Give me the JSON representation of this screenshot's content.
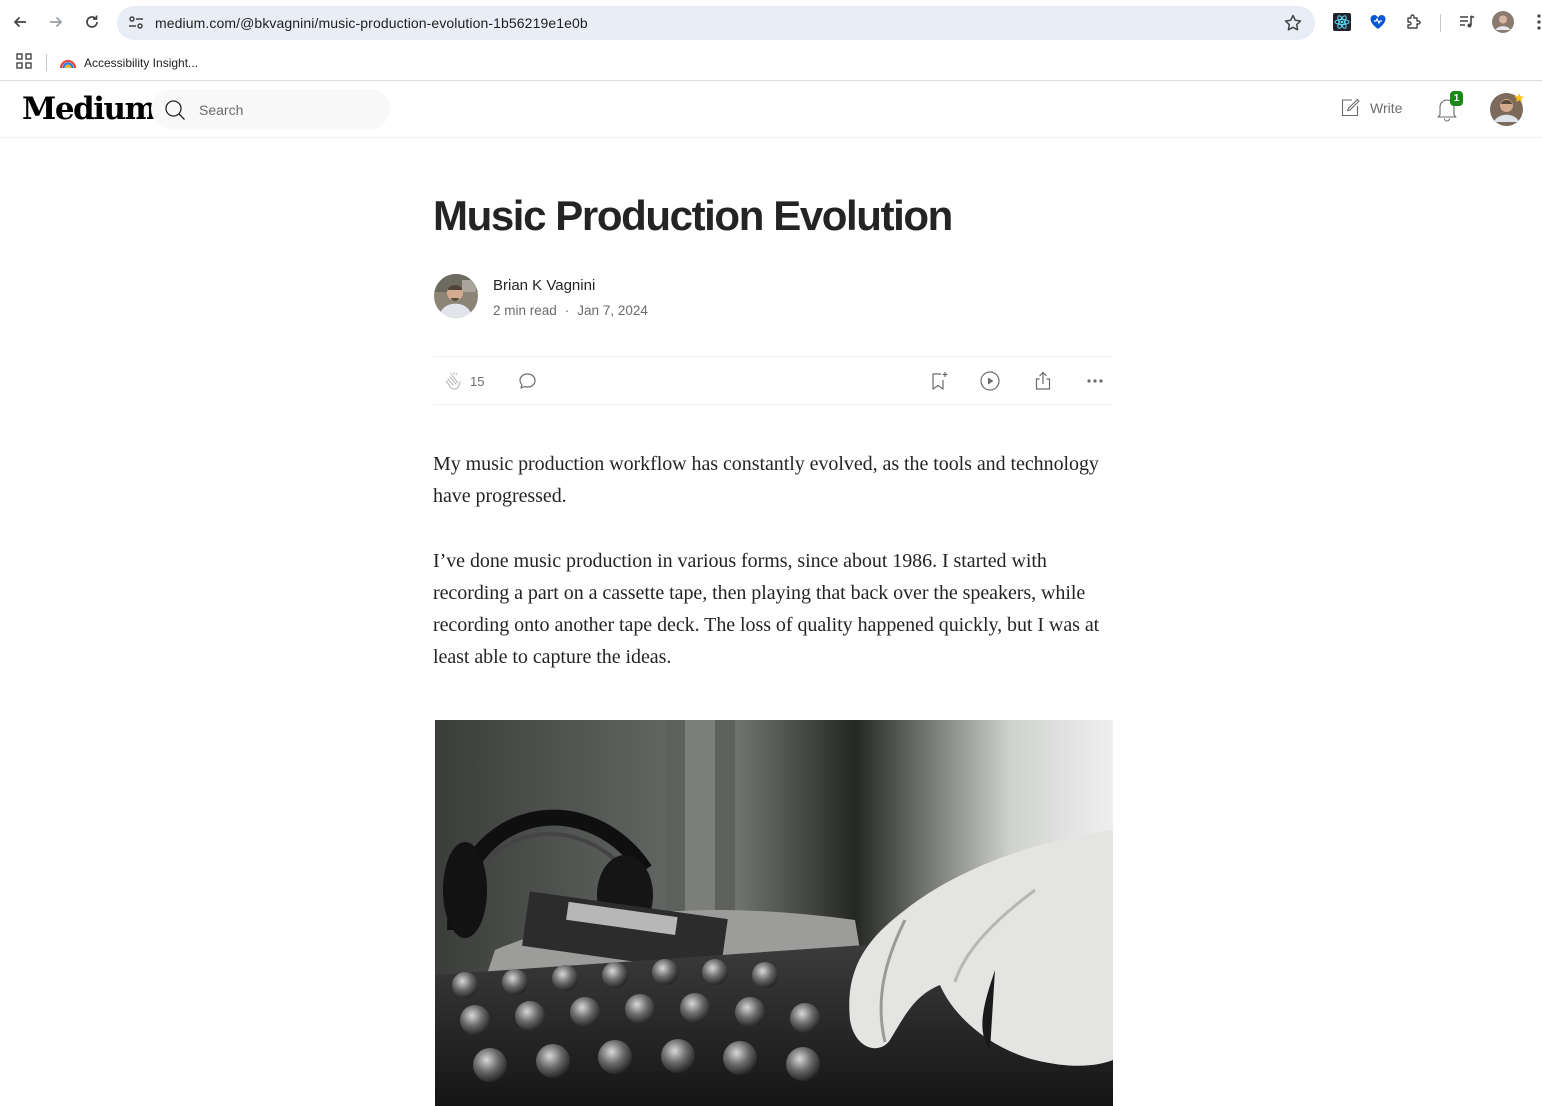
{
  "browser": {
    "url": "medium.com/@bkvagnini/music-production-evolution-1b56219e1e0b",
    "bookmarks": [
      {
        "label": "Accessibility Insight..."
      }
    ]
  },
  "medium": {
    "logo": "Medium",
    "search_placeholder": "Search",
    "write_label": "Write",
    "notification_count": "1"
  },
  "article": {
    "title": "Music Production Evolution",
    "author": "Brian K Vagnini",
    "read_time": "2 min read",
    "separator": "·",
    "date": "Jan 7, 2024",
    "claps": "15",
    "paragraphs": [
      "My music production workflow has constantly evolved, as the tools and technology have progressed.",
      "I’ve done music production in various forms, since about 1986. I started with recording a part on a cassette tape, then playing that back over the speakers, while recording onto another tape deck. The loss of quality happened quickly, but I was at least able to capture the ideas."
    ]
  },
  "colors": {
    "accent_green": "#1a8917",
    "text": "#242424",
    "muted": "#6b6b6b",
    "omnibox": "#e9eef6"
  }
}
